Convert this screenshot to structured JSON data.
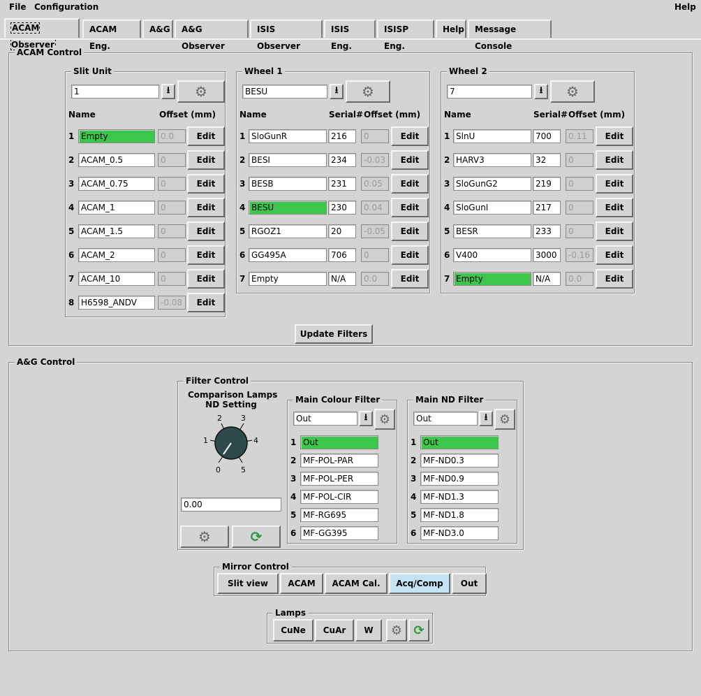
{
  "menu": {
    "file": "File",
    "configuration": "Configuration",
    "help": "Help"
  },
  "tabs": [
    "ACAM Observer",
    "ACAM Eng.",
    "A&G",
    "A&G Observer",
    "ISIS Observer",
    "ISIS Eng.",
    "ISISP Eng.",
    "Help",
    "Message Console"
  ],
  "acam": {
    "title": "ACAM Control",
    "slit": {
      "title": "Slit Unit",
      "selector": "1",
      "headers": {
        "name": "Name",
        "offset": "Offset (mm)"
      },
      "edit_label": "Edit",
      "rows": [
        {
          "idx": "1",
          "name": "Empty",
          "offset": "0.0",
          "selected": true
        },
        {
          "idx": "2",
          "name": "ACAM_0.5",
          "offset": "0"
        },
        {
          "idx": "3",
          "name": "ACAM_0.75",
          "offset": "0"
        },
        {
          "idx": "4",
          "name": "ACAM_1",
          "offset": "0"
        },
        {
          "idx": "5",
          "name": "ACAM_1.5",
          "offset": "0"
        },
        {
          "idx": "6",
          "name": "ACAM_2",
          "offset": "0"
        },
        {
          "idx": "7",
          "name": "ACAM_10",
          "offset": "0"
        },
        {
          "idx": "8",
          "name": "H6598_ANDV",
          "offset": "-0.08"
        }
      ]
    },
    "wheel1": {
      "title": "Wheel 1",
      "selector": "BESU",
      "headers": {
        "name": "Name",
        "serial": "Serial#",
        "offset": "Offset (mm)"
      },
      "edit_label": "Edit",
      "rows": [
        {
          "idx": "1",
          "name": "SloGunR",
          "serial": "216",
          "offset": "0"
        },
        {
          "idx": "2",
          "name": "BESI",
          "serial": "234",
          "offset": "-0.03"
        },
        {
          "idx": "3",
          "name": "BESB",
          "serial": "231",
          "offset": "0.05"
        },
        {
          "idx": "4",
          "name": "BESU",
          "serial": "230",
          "offset": "0.04",
          "selected": true
        },
        {
          "idx": "5",
          "name": "RGOZ1",
          "serial": "20",
          "offset": "-0.05"
        },
        {
          "idx": "6",
          "name": "GG495A",
          "serial": "706",
          "offset": "0"
        },
        {
          "idx": "7",
          "name": "Empty",
          "serial": "N/A",
          "offset": "0.0"
        }
      ]
    },
    "wheel2": {
      "title": "Wheel 2",
      "selector": "7",
      "headers": {
        "name": "Name",
        "serial": "Serial#",
        "offset": "Offset (mm)"
      },
      "edit_label": "Edit",
      "rows": [
        {
          "idx": "1",
          "name": "SlnU",
          "serial": "700",
          "offset": "0.11"
        },
        {
          "idx": "2",
          "name": "HARV3",
          "serial": "32",
          "offset": "0"
        },
        {
          "idx": "3",
          "name": "SloGunG2",
          "serial": "219",
          "offset": "0"
        },
        {
          "idx": "4",
          "name": "SloGunI",
          "serial": "217",
          "offset": "0"
        },
        {
          "idx": "5",
          "name": "BESR",
          "serial": "233",
          "offset": "0"
        },
        {
          "idx": "6",
          "name": "V400",
          "serial": "3000",
          "offset": "-0.16"
        },
        {
          "idx": "7",
          "name": "Empty",
          "serial": "N/A",
          "offset": "0.0",
          "selected": true
        }
      ]
    },
    "update_label": "Update Filters"
  },
  "ag": {
    "title": "A&G Control",
    "filter_control": {
      "title": "Filter Control",
      "lamps_title_1": "Comparison Lamps",
      "lamps_title_2": "ND Setting",
      "dial_ticks": [
        "0",
        "1",
        "2",
        "3",
        "4",
        "5"
      ],
      "dial_value": "0.00",
      "main_colour": {
        "title": "Main Colour Filter",
        "selector": "Out",
        "rows": [
          {
            "idx": "1",
            "name": "Out",
            "selected": true
          },
          {
            "idx": "2",
            "name": "MF-POL-PAR"
          },
          {
            "idx": "3",
            "name": "MF-POL-PER"
          },
          {
            "idx": "4",
            "name": "MF-POL-CIR"
          },
          {
            "idx": "5",
            "name": "MF-RG695"
          },
          {
            "idx": "6",
            "name": "MF-GG395"
          }
        ]
      },
      "main_nd": {
        "title": "Main ND Filter",
        "selector": "Out",
        "rows": [
          {
            "idx": "1",
            "name": "Out",
            "selected": true
          },
          {
            "idx": "2",
            "name": "MF-ND0.3"
          },
          {
            "idx": "3",
            "name": "MF-ND0.9"
          },
          {
            "idx": "4",
            "name": "MF-ND1.3"
          },
          {
            "idx": "5",
            "name": "MF-ND1.8"
          },
          {
            "idx": "6",
            "name": "MF-ND3.0"
          }
        ]
      }
    },
    "mirror": {
      "title": "Mirror Control",
      "buttons": [
        "Slit view",
        "ACAM",
        "ACAM Cal.",
        "Acq/Comp",
        "Out"
      ],
      "active": "Acq/Comp"
    },
    "lamps": {
      "title": "Lamps",
      "buttons": [
        "CuNe",
        "CuAr",
        "W"
      ]
    }
  },
  "colors": {
    "selected": "#3cc74c",
    "pressed": "#c5e2f5",
    "background": "#d4d4d4"
  }
}
